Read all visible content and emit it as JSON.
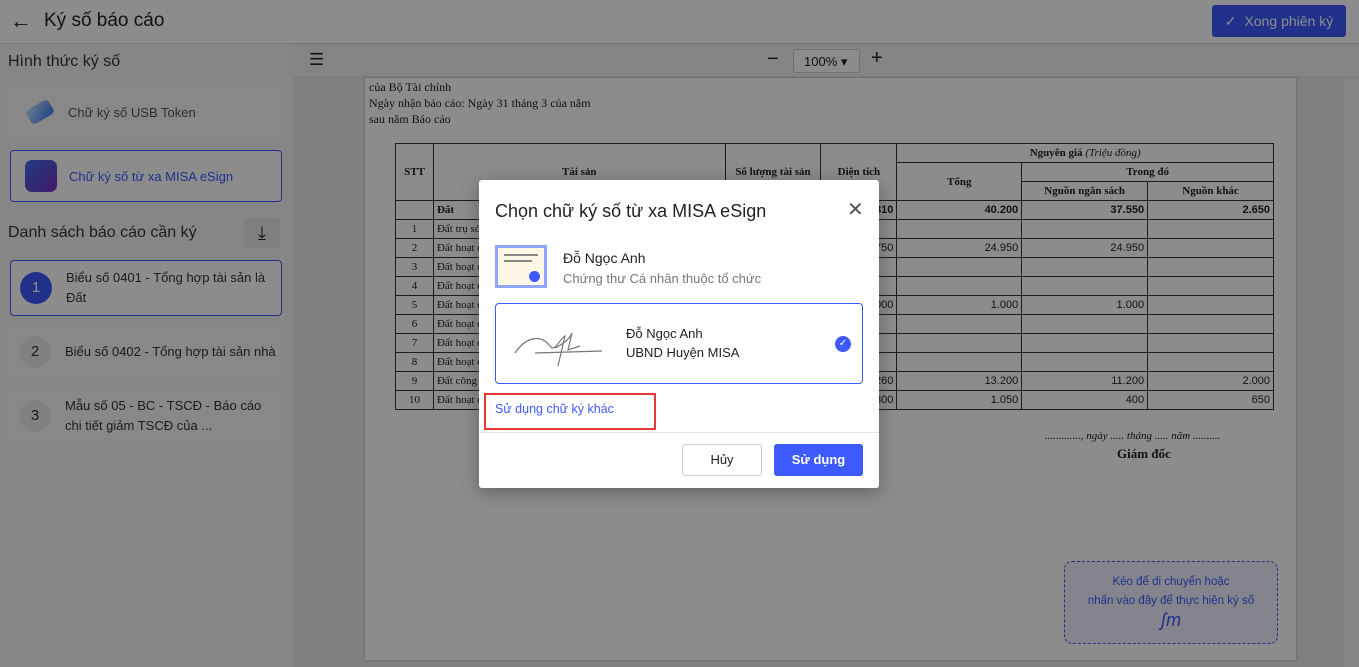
{
  "header": {
    "title": "Ký số báo cáo",
    "done_label": "Xong phiên ký"
  },
  "sidebar": {
    "methods_title": "Hình thức ký số",
    "methods": [
      {
        "label": "Chữ ký số USB Token",
        "icon": "usb-token-icon"
      },
      {
        "label": "Chữ ký số từ xa MISA eSign",
        "icon": "misa-esign-icon",
        "selected": true
      }
    ],
    "reports_title": "Danh sách báo cáo cần ký",
    "reports": [
      {
        "num": "1",
        "label": "Biểu số 0401 - Tổng hợp tài sản là Đất",
        "selected": true
      },
      {
        "num": "2",
        "label": "Biểu số 0402 - Tổng hợp tài sản nhà"
      },
      {
        "num": "3",
        "label": "Mẫu số 05 - BC - TSCĐ - Báo cáo chi tiết giảm TSCĐ của ..."
      }
    ]
  },
  "toolbar": {
    "zoom": "100%"
  },
  "document": {
    "lines": [
      "của Bộ Tài chính",
      "Ngày nhận báo cáo: Ngày 31 tháng 3 của năm",
      "sau năm Báo cáo"
    ],
    "headers": {
      "stt": "STT",
      "asset": "Tài sản",
      "qty": "Số lượng tài sản",
      "area": "Diện tích",
      "orig": "Nguyên giá",
      "orig_unit": "(Triệu đồng)",
      "total": "Tổng",
      "of_which": "Trong đó",
      "budget": "Nguồn ngân sách",
      "other": "Nguồn khác"
    },
    "rows": [
      {
        "stt": "",
        "asset": "Đất",
        "area": "810",
        "total": "40.200",
        "budget": "37.550",
        "other": "2.650",
        "bold": true
      },
      {
        "stt": "1",
        "asset": "Đất trụ sở",
        "area": "",
        "total": "",
        "budget": "",
        "other": ""
      },
      {
        "stt": "2",
        "asset": "Đất hoạt đ",
        "area": "750",
        "total": "24.950",
        "budget": "24.950",
        "other": ""
      },
      {
        "stt": "3",
        "asset": "Đất hoạt đ",
        "area": "",
        "total": "",
        "budget": "",
        "other": ""
      },
      {
        "stt": "4",
        "asset": "Đất hoạt đ",
        "area": "",
        "total": "",
        "budget": "",
        "other": ""
      },
      {
        "stt": "5",
        "asset": "Đất hoạt đ",
        "area": "000",
        "total": "1.000",
        "budget": "1.000",
        "other": ""
      },
      {
        "stt": "6",
        "asset": "Đất hoạt đ",
        "area": "",
        "total": "",
        "budget": "",
        "other": ""
      },
      {
        "stt": "7",
        "asset": "Đất hoạt đ",
        "area": "",
        "total": "",
        "budget": "",
        "other": ""
      },
      {
        "stt": "8",
        "asset": "Đất hoạt đ",
        "area": "",
        "total": "",
        "budget": "",
        "other": ""
      },
      {
        "stt": "9",
        "asset": "Đất công t",
        "area": "260",
        "total": "13.200",
        "budget": "11.200",
        "other": "2.000"
      },
      {
        "stt": "10",
        "asset": "Đất hoạt đ",
        "area": "800",
        "total": "1.050",
        "budget": "400",
        "other": "650"
      }
    ],
    "date_line": "............., ngày ..... tháng ..... năm ..........",
    "signer_title": "Giám đốc"
  },
  "drop_zone": {
    "line1": "Kéo để di chuyển hoặc",
    "line2": "nhấn vào đây để thực hiện ký số"
  },
  "dialog": {
    "title": "Chọn chữ ký số từ xa MISA eSign",
    "cert_name": "Đỗ Ngọc Anh",
    "cert_type": "Chứng thư Cá nhân thuộc tổ chức",
    "signature_name": "Đỗ Ngọc Anh",
    "signature_org": "UBND Huyện MISA",
    "other_link": "Sử dụng chữ ký khác",
    "cancel": "Hủy",
    "use": "Sử dụng"
  },
  "colors": {
    "accent": "#3d5afe",
    "highlight": "#e53935"
  }
}
